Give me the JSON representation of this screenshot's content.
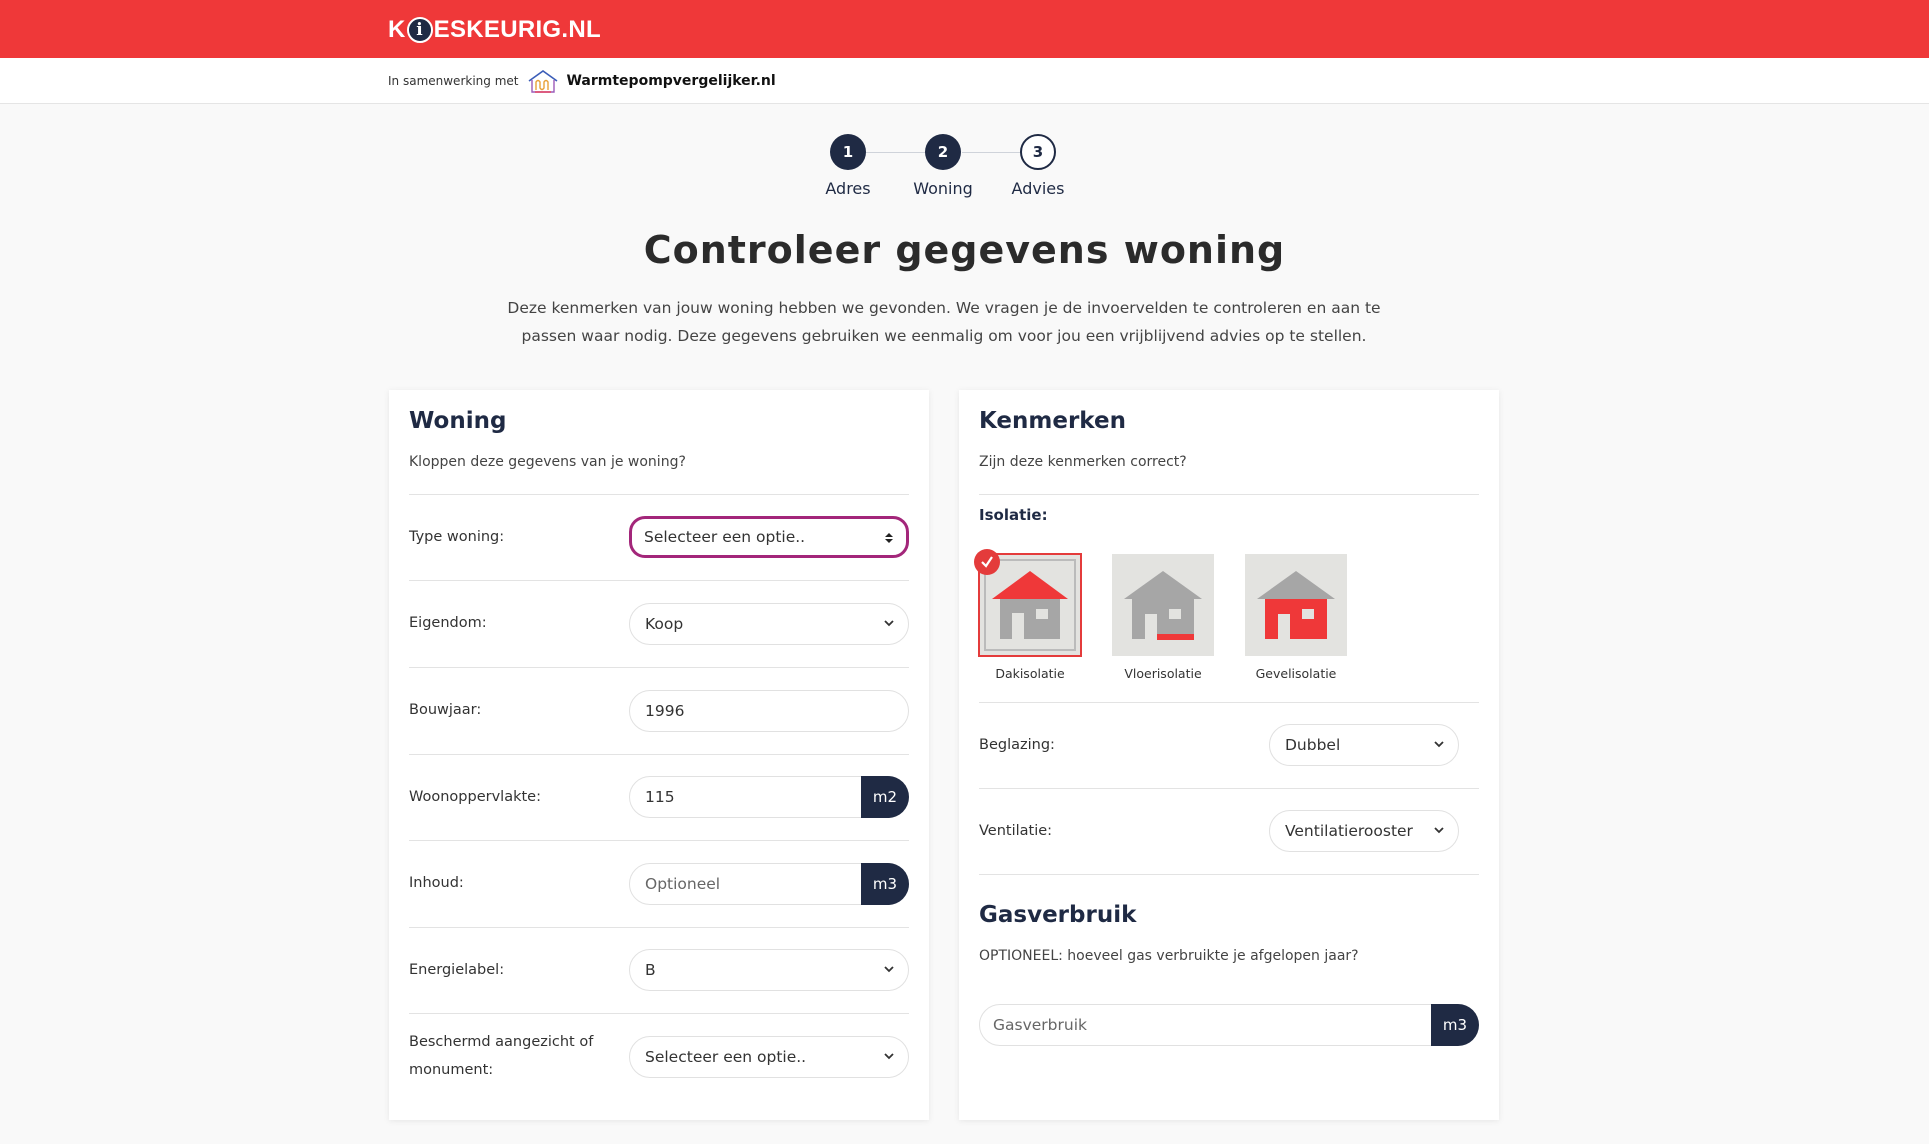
{
  "brand": {
    "logo_pre": "K",
    "logo_post": "ESKEURIG.NL",
    "color": "#ef3839"
  },
  "partner": {
    "prefix": "In samenwerking met",
    "name": "Warmtepompvergelijker.nl"
  },
  "steps": [
    {
      "number": "1",
      "label": "Adres",
      "state": "done"
    },
    {
      "number": "2",
      "label": "Woning",
      "state": "done"
    },
    {
      "number": "3",
      "label": "Advies",
      "state": "todo"
    }
  ],
  "page": {
    "title": "Controleer gegevens woning",
    "intro": "Deze kenmerken van jouw woning hebben we gevonden. We vragen je de invoervelden te controleren en aan te passen waar nodig. Deze gegevens gebruiken we eenmalig om voor jou een vrijblijvend advies op te stellen."
  },
  "woning": {
    "title": "Woning",
    "subtitle": "Kloppen deze gegevens van je woning?",
    "type": {
      "label": "Type woning:",
      "value": "Selecteer een optie.."
    },
    "eigendom": {
      "label": "Eigendom:",
      "value": "Koop"
    },
    "bouwjaar": {
      "label": "Bouwjaar:",
      "value": "1996"
    },
    "oppervlakte": {
      "label": "Woonoppervlakte:",
      "value": "115",
      "unit": "m2"
    },
    "inhoud": {
      "label": "Inhoud:",
      "placeholder": "Optioneel",
      "unit": "m3"
    },
    "energielabel": {
      "label": "Energielabel:",
      "value": "B"
    },
    "monument": {
      "label_line1": "Beschermd aangezicht of",
      "label_line2": "monument:",
      "value": "Selecteer een optie.."
    }
  },
  "kenmerken": {
    "title": "Kenmerken",
    "subtitle": "Zijn deze kenmerken correct?",
    "isolatie_label": "Isolatie:",
    "isolatie": [
      {
        "label": "Dakisolatie",
        "selected": true
      },
      {
        "label": "Vloerisolatie",
        "selected": false
      },
      {
        "label": "Gevelisolatie",
        "selected": false
      }
    ],
    "beglazing": {
      "label": "Beglazing:",
      "value": "Dubbel"
    },
    "ventilatie": {
      "label": "Ventilatie:",
      "value": "Ventilatierooster"
    }
  },
  "gasverbruik": {
    "title": "Gasverbruik",
    "subtitle": "OPTIONEEL: hoeveel gas verbruikte je afgelopen jaar?",
    "placeholder": "Gasverbruik",
    "unit": "m3"
  },
  "colors": {
    "navy": "#1f2a44",
    "red": "#ef3839",
    "focus": "#a3267a",
    "house_grey": "#a6a6a6"
  }
}
